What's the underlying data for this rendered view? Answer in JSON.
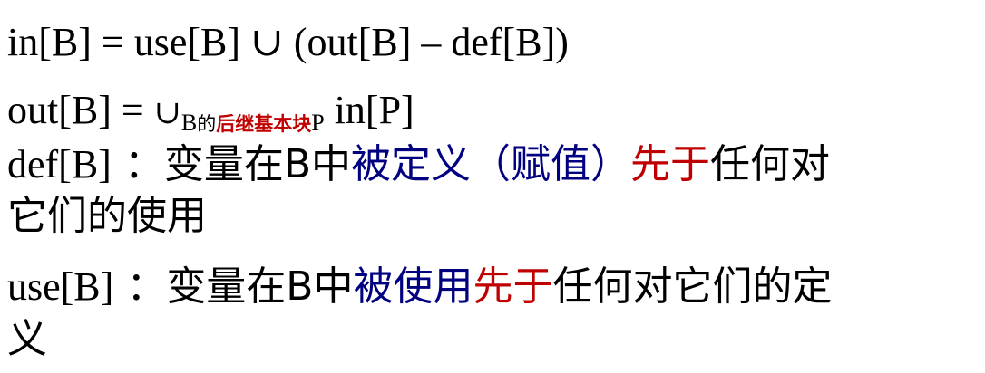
{
  "line1": {
    "text": "in[B] = use[B] ∪ (out[B] – def[B])"
  },
  "line2": {
    "prefix": "out[B] = ",
    "union": "∪",
    "sub_b": "B",
    "sub_de": "的",
    "sub_successor": "后继基本块",
    "sub_p": "P",
    "suffix": " in[P]"
  },
  "line3": {
    "prefix": "def[B]",
    "colon": "：",
    "text1": "变量在B中",
    "blue": "被定义（赋值）",
    "red": "先于",
    "text2": "任何对"
  },
  "line4": {
    "text": "它们的使用"
  },
  "line5": {
    "prefix": "use[B]",
    "colon": "：",
    "text1": "变量在B中",
    "blue": "被使用",
    "red": "先于",
    "text2": "任何对它们的定"
  },
  "line6": {
    "text": "义"
  },
  "colors": {
    "blue": "#000080",
    "red": "#c00000",
    "text": "#000000"
  }
}
